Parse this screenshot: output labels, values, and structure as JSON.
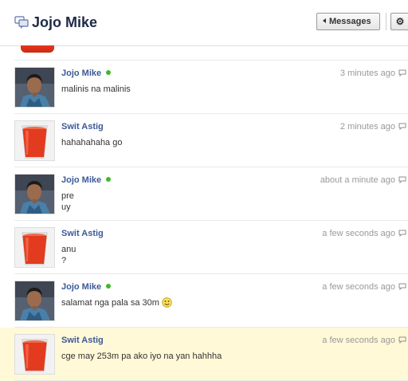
{
  "header": {
    "title": "Jojo Mike",
    "messages_button": "Messages",
    "settings_icon": "gear-icon",
    "title_icon": "chat-bubbles-icon"
  },
  "messages": [
    {
      "name": "Jojo Mike",
      "online": true,
      "time": "3 minutes ago",
      "lines": [
        "malinis na malinis"
      ],
      "avatar": "person-photo"
    },
    {
      "name": "Swit Astig",
      "online": false,
      "time": "2 minutes ago",
      "lines": [
        "hahahahaha go"
      ],
      "avatar": "red-drink-glass"
    },
    {
      "name": "Jojo Mike",
      "online": true,
      "time": "about a minute ago",
      "lines": [
        "pre",
        "uy"
      ],
      "avatar": "person-photo"
    },
    {
      "name": "Swit Astig",
      "online": false,
      "time": "a few seconds ago",
      "lines": [
        "anu",
        "?"
      ],
      "avatar": "red-drink-glass"
    },
    {
      "name": "Jojo Mike",
      "online": true,
      "time": "a few seconds ago",
      "lines": [
        "salamat nga pala sa 30m"
      ],
      "emoticon": "smiley-icon",
      "avatar": "person-photo"
    },
    {
      "name": "Swit Astig",
      "online": false,
      "time": "a few seconds ago",
      "lines": [
        "cge may 253m pa ako iyo na yan hahhha"
      ],
      "avatar": "red-drink-glass",
      "highlighted": true
    }
  ],
  "colors": {
    "name_link": "#3b5998",
    "online_dot": "#42b72a",
    "highlight_bg": "#fff9d7",
    "timestamp": "#999999"
  }
}
